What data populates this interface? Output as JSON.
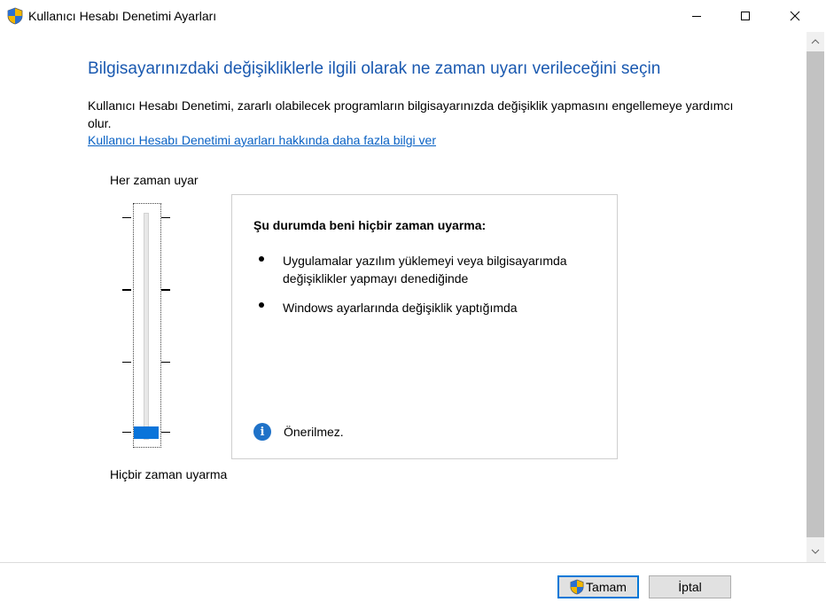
{
  "window": {
    "title": "Kullanıcı Hesabı Denetimi Ayarları",
    "controls": [
      "minimize-icon",
      "maximize-icon",
      "close-icon"
    ]
  },
  "content": {
    "heading": "Bilgisayarınızdaki değişikliklerle ilgili olarak ne zaman uyarı verileceğini seçin",
    "description": "Kullanıcı Hesabı Denetimi, zararlı olabilecek programların bilgisayarınızda değişiklik yapmasını engellemeye yardımcı olur.",
    "learn_more_link": "Kullanıcı Hesabı Denetimi ayarları hakkında daha fazla bilgi ver"
  },
  "slider": {
    "top_label": "Her zaman uyar",
    "bottom_label": "Hiçbir zaman uyarma",
    "levels": 4,
    "selected_level": 1
  },
  "panel": {
    "title": "Şu durumda beni hiçbir zaman uyarma:",
    "bullets": [
      "Uygulamalar yazılım yüklemeyi veya bilgisayarımda değişiklikler yapmayı denediğinde",
      "Windows ayarlarında değişiklik yaptığımda"
    ],
    "info_text": "Önerilmez."
  },
  "buttons": {
    "ok": "Tamam",
    "cancel": "İptal"
  },
  "colors": {
    "heading": "#1a59b0",
    "link": "#0a62c4",
    "accent": "#0078d7",
    "slider_thumb": "#0a74da"
  }
}
